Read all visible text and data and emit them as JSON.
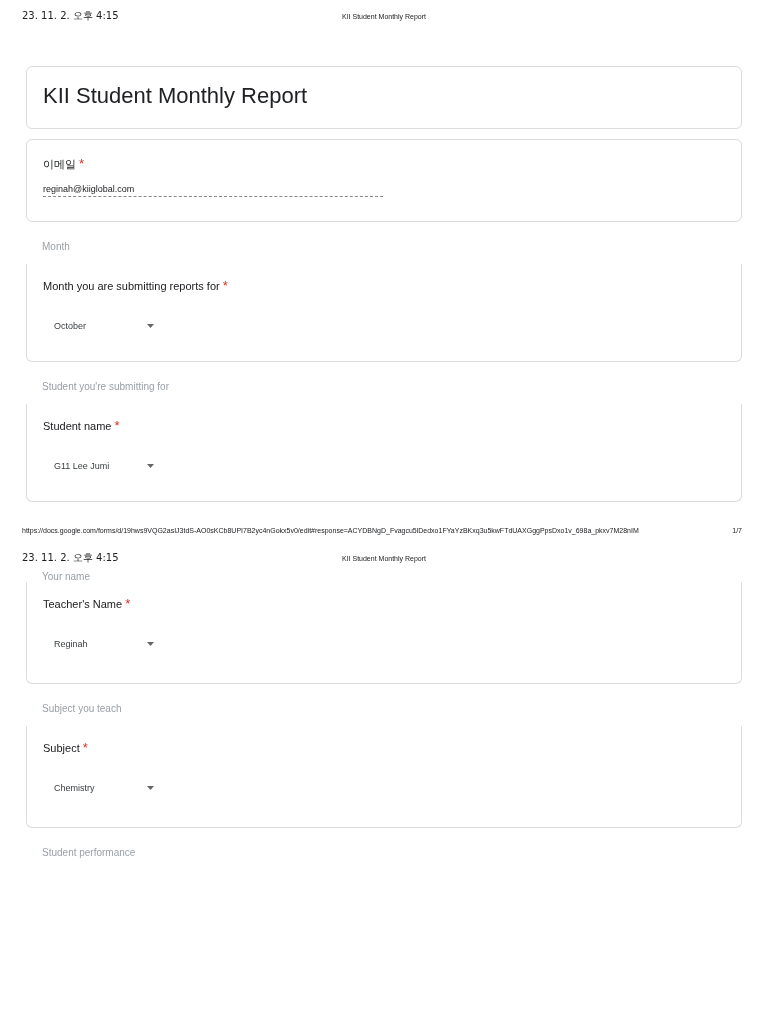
{
  "pages": [
    {
      "header": {
        "date": "23. 11. 2. 오후 4:15",
        "title": "KII Student Monthly Report"
      },
      "blocks": [
        {
          "kind": "title",
          "text": "KII Student Monthly Report"
        },
        {
          "kind": "text_question",
          "label": "이메일",
          "required_mark": "*",
          "value": "reginah@kiiglobal.com"
        },
        {
          "kind": "section",
          "text": "Month"
        },
        {
          "kind": "dropdown",
          "label": "Month you are submitting reports for",
          "required_mark": "*",
          "value": "October"
        },
        {
          "kind": "section",
          "text": "Student you're submitting for"
        },
        {
          "kind": "dropdown",
          "label": "Student name",
          "required_mark": "*",
          "value": "G11 Lee Jumi"
        }
      ],
      "footer": {
        "url": "https://docs.google.com/forms/d/19hws9VQG2asIJ3tdS-AO0sKCb8UPI7B2yc4nGokx5v0/edit#response=ACYDBNgD_Fvagcu5lDedxo1FYaYzBKxq3u5kwFTdUAXGggPpsDxo1v_698a_pkxv7M28nIM",
        "page": "1/7"
      }
    },
    {
      "header": {
        "date": "23. 11. 2. 오후 4:15",
        "title": "KII Student Monthly Report"
      },
      "blocks": [
        {
          "kind": "section",
          "text": "Your name"
        },
        {
          "kind": "dropdown",
          "label": "Teacher's Name",
          "required_mark": "*",
          "value": "Reginah"
        },
        {
          "kind": "section",
          "text": "Subject you teach"
        },
        {
          "kind": "dropdown",
          "label": "Subject",
          "required_mark": "*",
          "value": "Chemistry"
        },
        {
          "kind": "section",
          "text": "Student performance"
        }
      ]
    }
  ]
}
